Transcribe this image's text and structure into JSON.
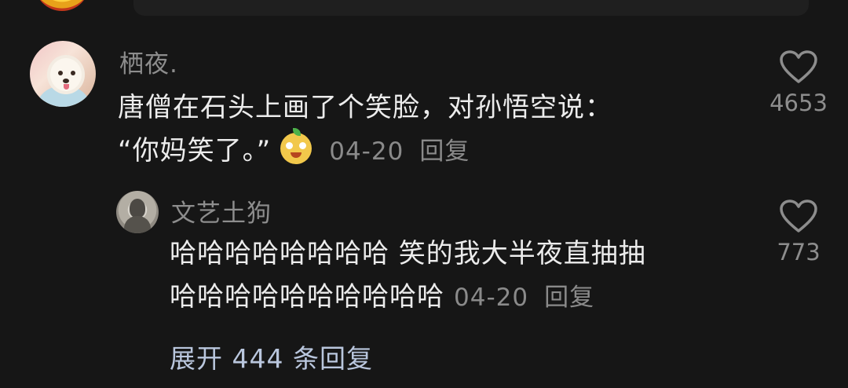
{
  "comment": {
    "username": "栖夜.",
    "text_line1": "唐僧在石头上画了个笑脸，对孙悟空说：",
    "text_line2": "“你妈笑了。”",
    "date": "04-20",
    "reply_label": "回复",
    "like_count": "4653"
  },
  "reply": {
    "username": "文艺土狗",
    "text_line1": "哈哈哈哈哈哈哈哈 笑的我大半夜直抽抽",
    "text_line2": "哈哈哈哈哈哈哈哈哈哈",
    "date": "04-20",
    "reply_label": "回复",
    "like_count": "773"
  },
  "expand": {
    "label": "展开 444 条回复"
  },
  "icons": {
    "like": "heart-outline-icon",
    "emoji": "smiling-fruit-emoji-icon"
  },
  "colors": {
    "background": "#161616",
    "primary_text": "#ececec",
    "secondary_text": "#8a8a8a",
    "link": "#b9c6dd"
  }
}
